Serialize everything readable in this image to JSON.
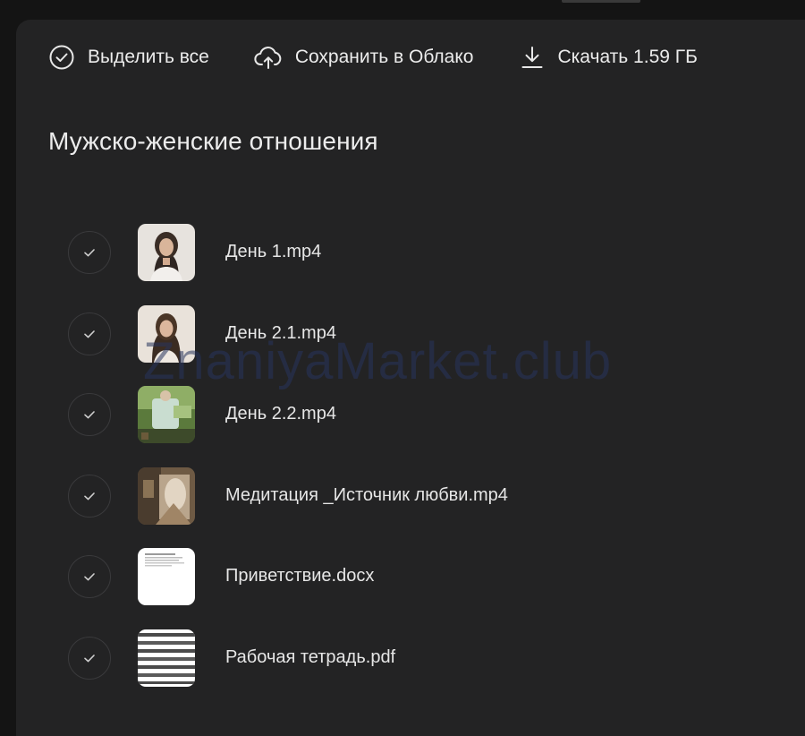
{
  "toolbar": {
    "select_all_label": "Выделить все",
    "save_cloud_label": "Сохранить в Облако",
    "download_label": "Скачать 1.59 ГБ"
  },
  "folder": {
    "title": "Мужско-женские отношения"
  },
  "files": [
    {
      "name": "День 1.mp4",
      "thumb": "video-portrait-thumbnail"
    },
    {
      "name": "День 2.1.mp4",
      "thumb": "video-portrait-thumbnail"
    },
    {
      "name": "День 2.2.mp4",
      "thumb": "video-scene-thumbnail"
    },
    {
      "name": "Медитация _Источник любви.mp4",
      "thumb": "video-scene-thumbnail"
    },
    {
      "name": "Приветствие.docx",
      "thumb": "document-thumbnail"
    },
    {
      "name": "Рабочая тетрадь.pdf",
      "thumb": "pdf-thumbnail"
    }
  ],
  "watermark": "ZnaniyaMarket.club",
  "colors": {
    "background": "#141414",
    "panel": "#232324",
    "text": "#e8e8e8",
    "check_border": "#3a3a3c"
  }
}
